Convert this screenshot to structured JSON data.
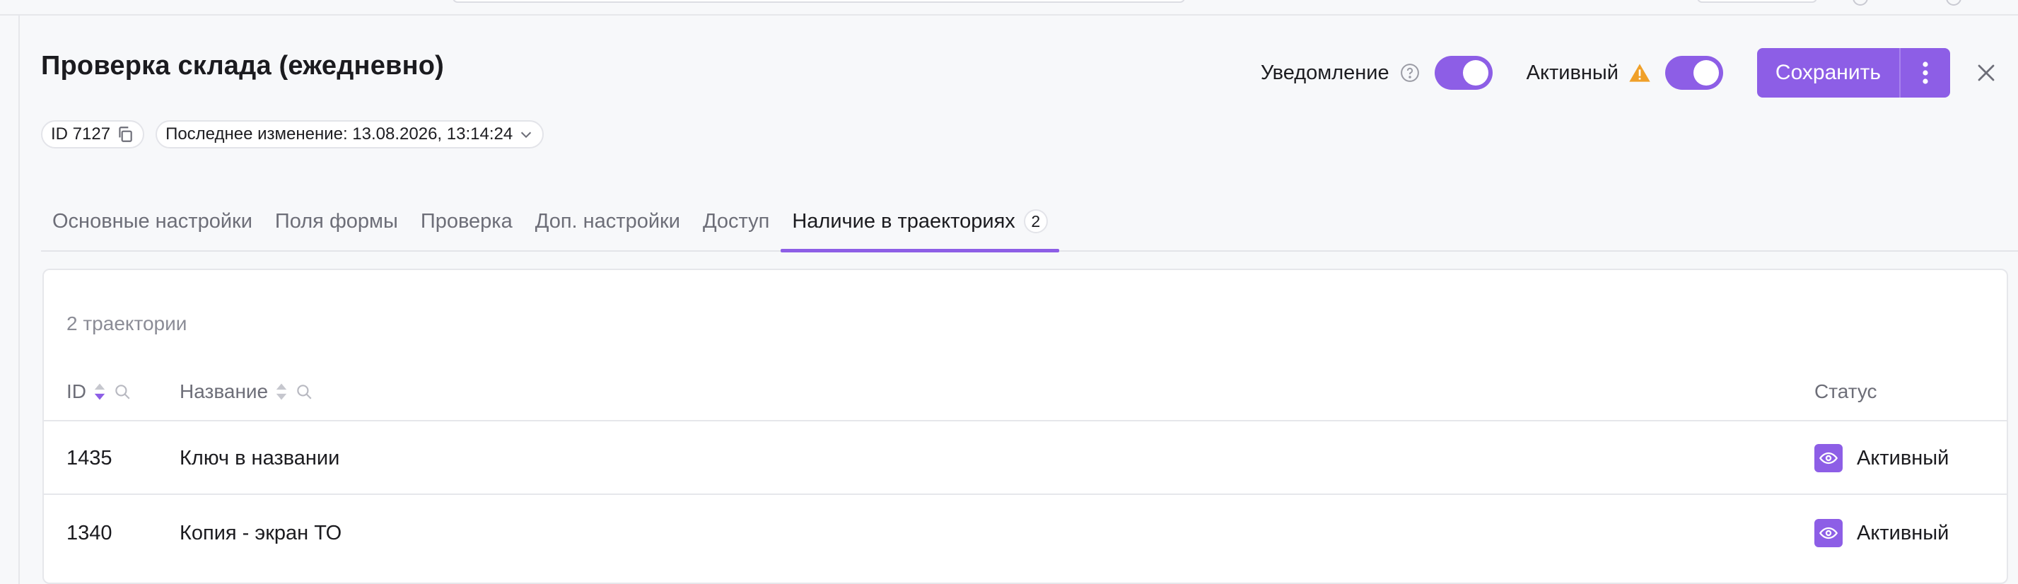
{
  "header": {
    "title": "Проверка склада (ежедневно)",
    "id_chip": "ID 7127",
    "last_modified": "Последнее изменение: 13.08.2026, 13:14:24",
    "notification_label": "Уведомление",
    "notification_enabled": true,
    "active_label": "Активный",
    "active_enabled": true,
    "save_label": "Сохранить"
  },
  "tabs": [
    {
      "label": "Основные настройки"
    },
    {
      "label": "Поля формы"
    },
    {
      "label": "Проверка"
    },
    {
      "label": "Доп. настройки"
    },
    {
      "label": "Доступ"
    },
    {
      "label": "Наличие в траекториях",
      "badge": "2",
      "active": true
    }
  ],
  "table": {
    "count_label": "2 траектории",
    "columns": {
      "id": "ID",
      "name": "Название",
      "status": "Статус"
    },
    "rows": [
      {
        "id": "1435",
        "name": "Ключ в названии",
        "status": "Активный"
      },
      {
        "id": "1340",
        "name": "Копия - экран ТО",
        "status": "Активный"
      }
    ]
  },
  "colors": {
    "accent": "#8d5ee6",
    "warning": "#f0a029"
  },
  "icons": [
    "copy-icon",
    "chevron-down-icon",
    "help-icon",
    "warning-icon",
    "more-vertical-icon",
    "close-icon",
    "sort-icon",
    "search-icon",
    "eye-icon"
  ]
}
